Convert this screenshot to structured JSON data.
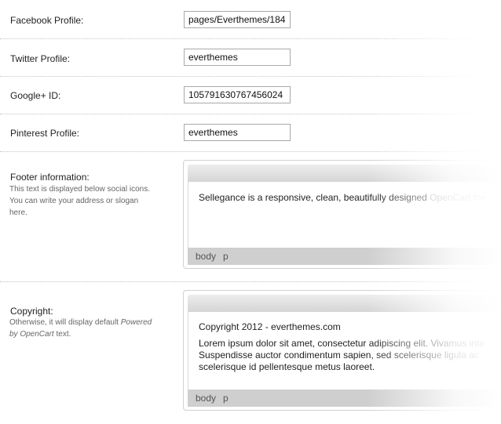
{
  "fields": {
    "facebook": {
      "label": "Facebook Profile:",
      "value": "pages/Everthemes/184"
    },
    "twitter": {
      "label": "Twitter Profile:",
      "value": "everthemes"
    },
    "googleplus": {
      "label": "Google+ ID:",
      "value": "105791630767456024"
    },
    "pinterest": {
      "label": "Pinterest Profile:",
      "value": "everthemes"
    }
  },
  "footer": {
    "label": "Footer information:",
    "help": [
      "This text is displayed below social icons.",
      "You can write your address or slogan",
      "here."
    ],
    "content_dark": "Sellegance is a responsive, clean, beautifully designed ",
    "content_faded": "OpenCart the",
    "status": [
      "body",
      "p"
    ]
  },
  "copyright": {
    "label": "Copyright:",
    "help_prefix": "Otherwise, it will display default ",
    "help_em1": "Powered",
    "help_em2": "by OpenCart",
    "help_suffix": " text.",
    "line1": "Copyright 2012 - everthemes.com",
    "para_lines": [
      "Lorem ipsum dolor sit amet, consectetur adipiscing elit. Vivamus inte",
      "Suspendisse auctor condimentum sapien, sed scelerisque ligula ac",
      "scelerisque id pellentesque metus laoreet."
    ],
    "status": [
      "body",
      "p"
    ]
  }
}
